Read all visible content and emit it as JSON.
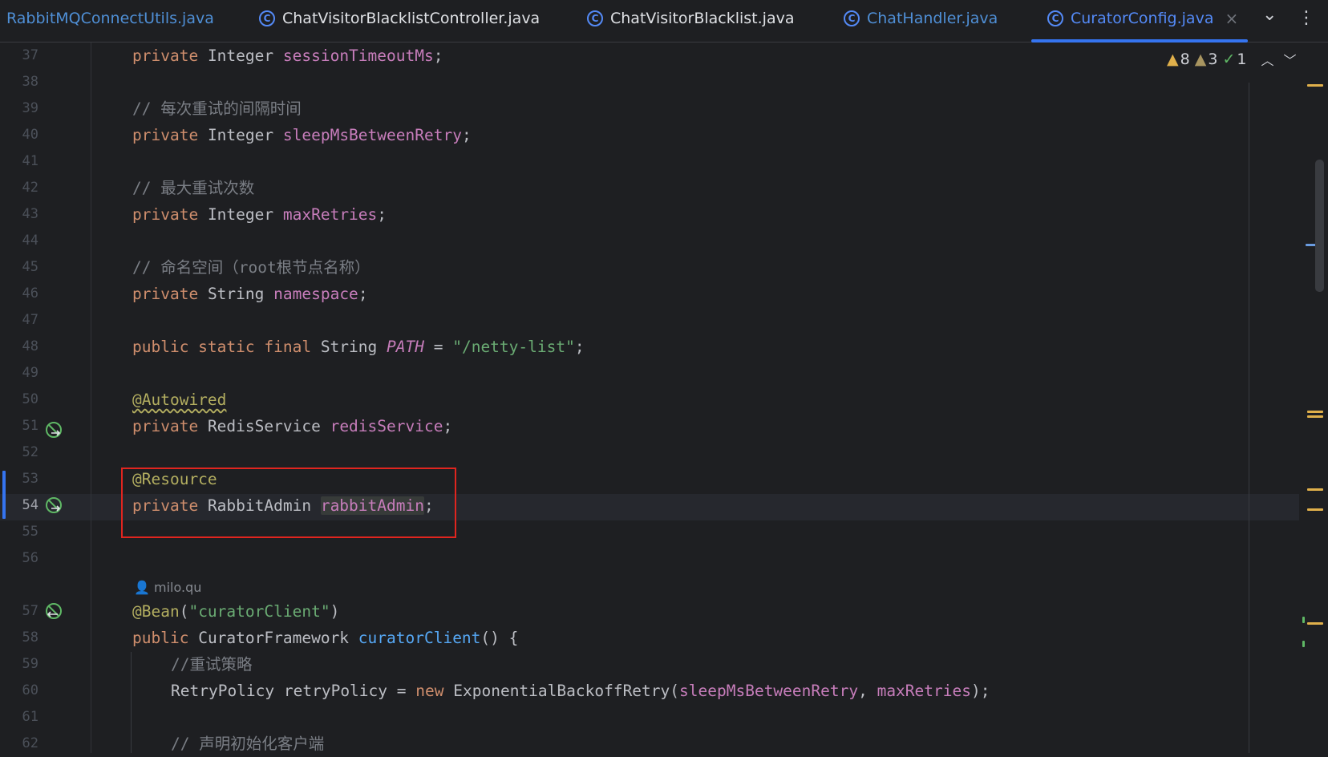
{
  "tabs": [
    {
      "label": "RabbitMQConnectUtils.java",
      "icon": "class-icon",
      "state": "modified"
    },
    {
      "label": "ChatVisitorBlacklistController.java",
      "icon": "class-icon",
      "state": "normal"
    },
    {
      "label": "ChatVisitorBlacklist.java",
      "icon": "class-icon",
      "state": "normal"
    },
    {
      "label": "ChatHandler.java",
      "icon": "class-icon",
      "state": "modified"
    },
    {
      "label": "CuratorConfig.java",
      "icon": "class-icon",
      "state": "active"
    }
  ],
  "tab_close_glyph": "×",
  "tab_more_glyph": "⌄",
  "tab_menu_glyph": "⋮",
  "tab_class_glyph": "C",
  "inspections": {
    "warnings": "8",
    "weak_warnings": "3",
    "typos": "1"
  },
  "editor": {
    "current_line": 54,
    "author_hint": "milo.qu",
    "lines": [
      {
        "n": "37",
        "text": "private Integer sessionTimeoutMs;"
      },
      {
        "n": "38",
        "text": ""
      },
      {
        "n": "39",
        "text": "// 每次重试的间隔时间"
      },
      {
        "n": "40",
        "text": "private Integer sleepMsBetweenRetry;"
      },
      {
        "n": "41",
        "text": ""
      },
      {
        "n": "42",
        "text": "// 最大重试次数"
      },
      {
        "n": "43",
        "text": "private Integer maxRetries;"
      },
      {
        "n": "44",
        "text": ""
      },
      {
        "n": "45",
        "text": "// 命名空间（root根节点名称）"
      },
      {
        "n": "46",
        "text": "private String namespace;"
      },
      {
        "n": "47",
        "text": ""
      },
      {
        "n": "48",
        "text": "public static final String PATH = \"/netty-list\";"
      },
      {
        "n": "49",
        "text": ""
      },
      {
        "n": "50",
        "text": "@Autowired"
      },
      {
        "n": "51",
        "text": "private RedisService redisService;"
      },
      {
        "n": "52",
        "text": ""
      },
      {
        "n": "53",
        "text": "@Resource"
      },
      {
        "n": "54",
        "text": "private RabbitAdmin rabbitAdmin;"
      },
      {
        "n": "55",
        "text": ""
      },
      {
        "n": "56",
        "text": ""
      },
      {
        "n": "57",
        "text": "@Bean(\"curatorClient\")"
      },
      {
        "n": "58",
        "text": "public CuratorFramework curatorClient() {"
      },
      {
        "n": "59",
        "text": "//重试策略"
      },
      {
        "n": "60",
        "text": "RetryPolicy retryPolicy = new ExponentialBackoffRetry(sleepMsBetweenRetry, maxRetries);"
      },
      {
        "n": "61",
        "text": ""
      },
      {
        "n": "62",
        "text": "// 声明初始化客户端"
      }
    ]
  }
}
